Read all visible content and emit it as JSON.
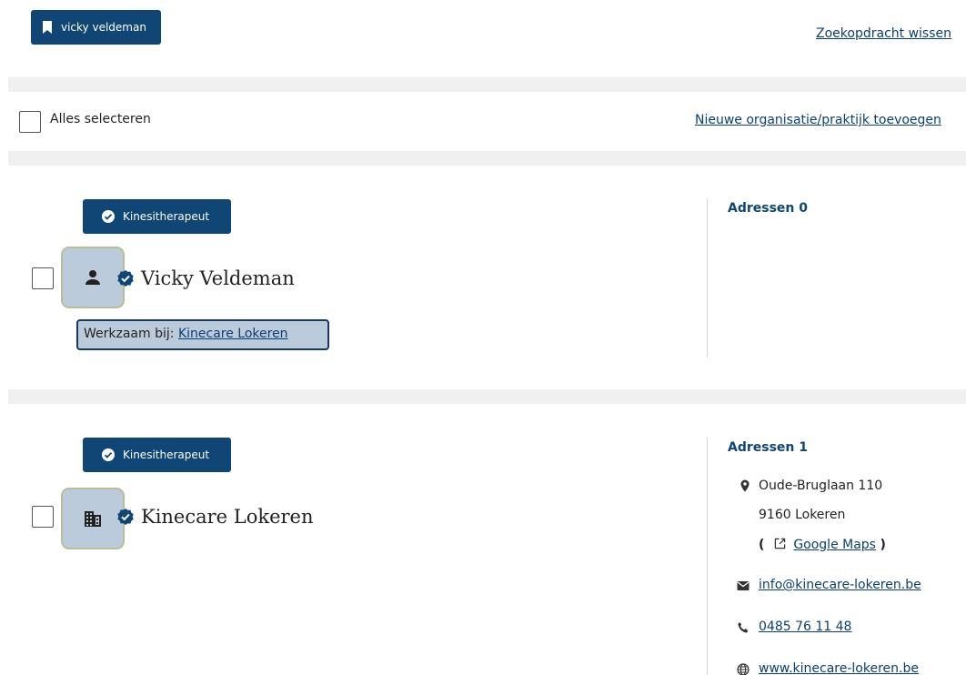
{
  "search": {
    "tag_label": "vicky veldeman",
    "clear_link": "Zoekopdracht wissen"
  },
  "toolbar": {
    "select_all_label": "Alles selecteren",
    "new_org_link": "Nieuwe organisatie/praktijk toevoegen"
  },
  "results": [
    {
      "badge": "Kinesitherapeut",
      "name": "Vicky Veldeman",
      "avatar_icon": "person-icon",
      "works_at_label": "Werkzaam bij:",
      "works_at_link": "Kinecare Lokeren",
      "addresses_label": "Adressen",
      "addresses_count": "0"
    },
    {
      "badge": "Kinesitherapeut",
      "name": "Kinecare Lokeren",
      "avatar_icon": "building-icon",
      "addresses_label": "Adressen",
      "addresses_count": "1",
      "address": {
        "street": "Oude-Bruglaan 110",
        "city": "9160 Lokeren",
        "maps_open": "(",
        "maps_link": "Google Maps",
        "maps_close": ")",
        "email": "info@kinecare-lokeren.be",
        "phone": "0485 76 11 48",
        "website": "www.kinecare-lokeren.be"
      }
    }
  ],
  "colors": {
    "primary": "#0f4675",
    "link": "#0b3f73",
    "avatar_bg": "#bccbdb",
    "band": "#f0f0f0"
  }
}
